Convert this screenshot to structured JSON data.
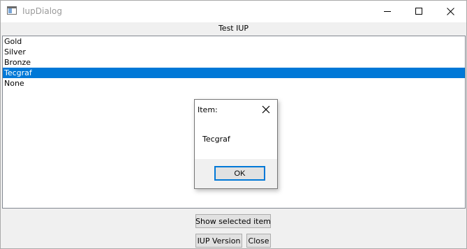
{
  "window": {
    "title": "IupDialog"
  },
  "label": "Test IUP",
  "list": {
    "items": [
      "Gold",
      "Silver",
      "Bronze",
      "Tecgraf",
      "None"
    ],
    "selected": "Tecgraf"
  },
  "buttons": {
    "show_selected": "Show selected item",
    "version": "IUP Version",
    "close": "Close"
  },
  "message_dialog": {
    "title": "Item:",
    "message": "Tecgraf",
    "ok": "OK"
  },
  "colors": {
    "selection": "#0078d7",
    "window_bg": "#f0f0f0"
  },
  "icons": {
    "app": "app-window-icon",
    "minimize": "minimize-icon",
    "maximize": "maximize-icon",
    "close": "close-icon"
  }
}
